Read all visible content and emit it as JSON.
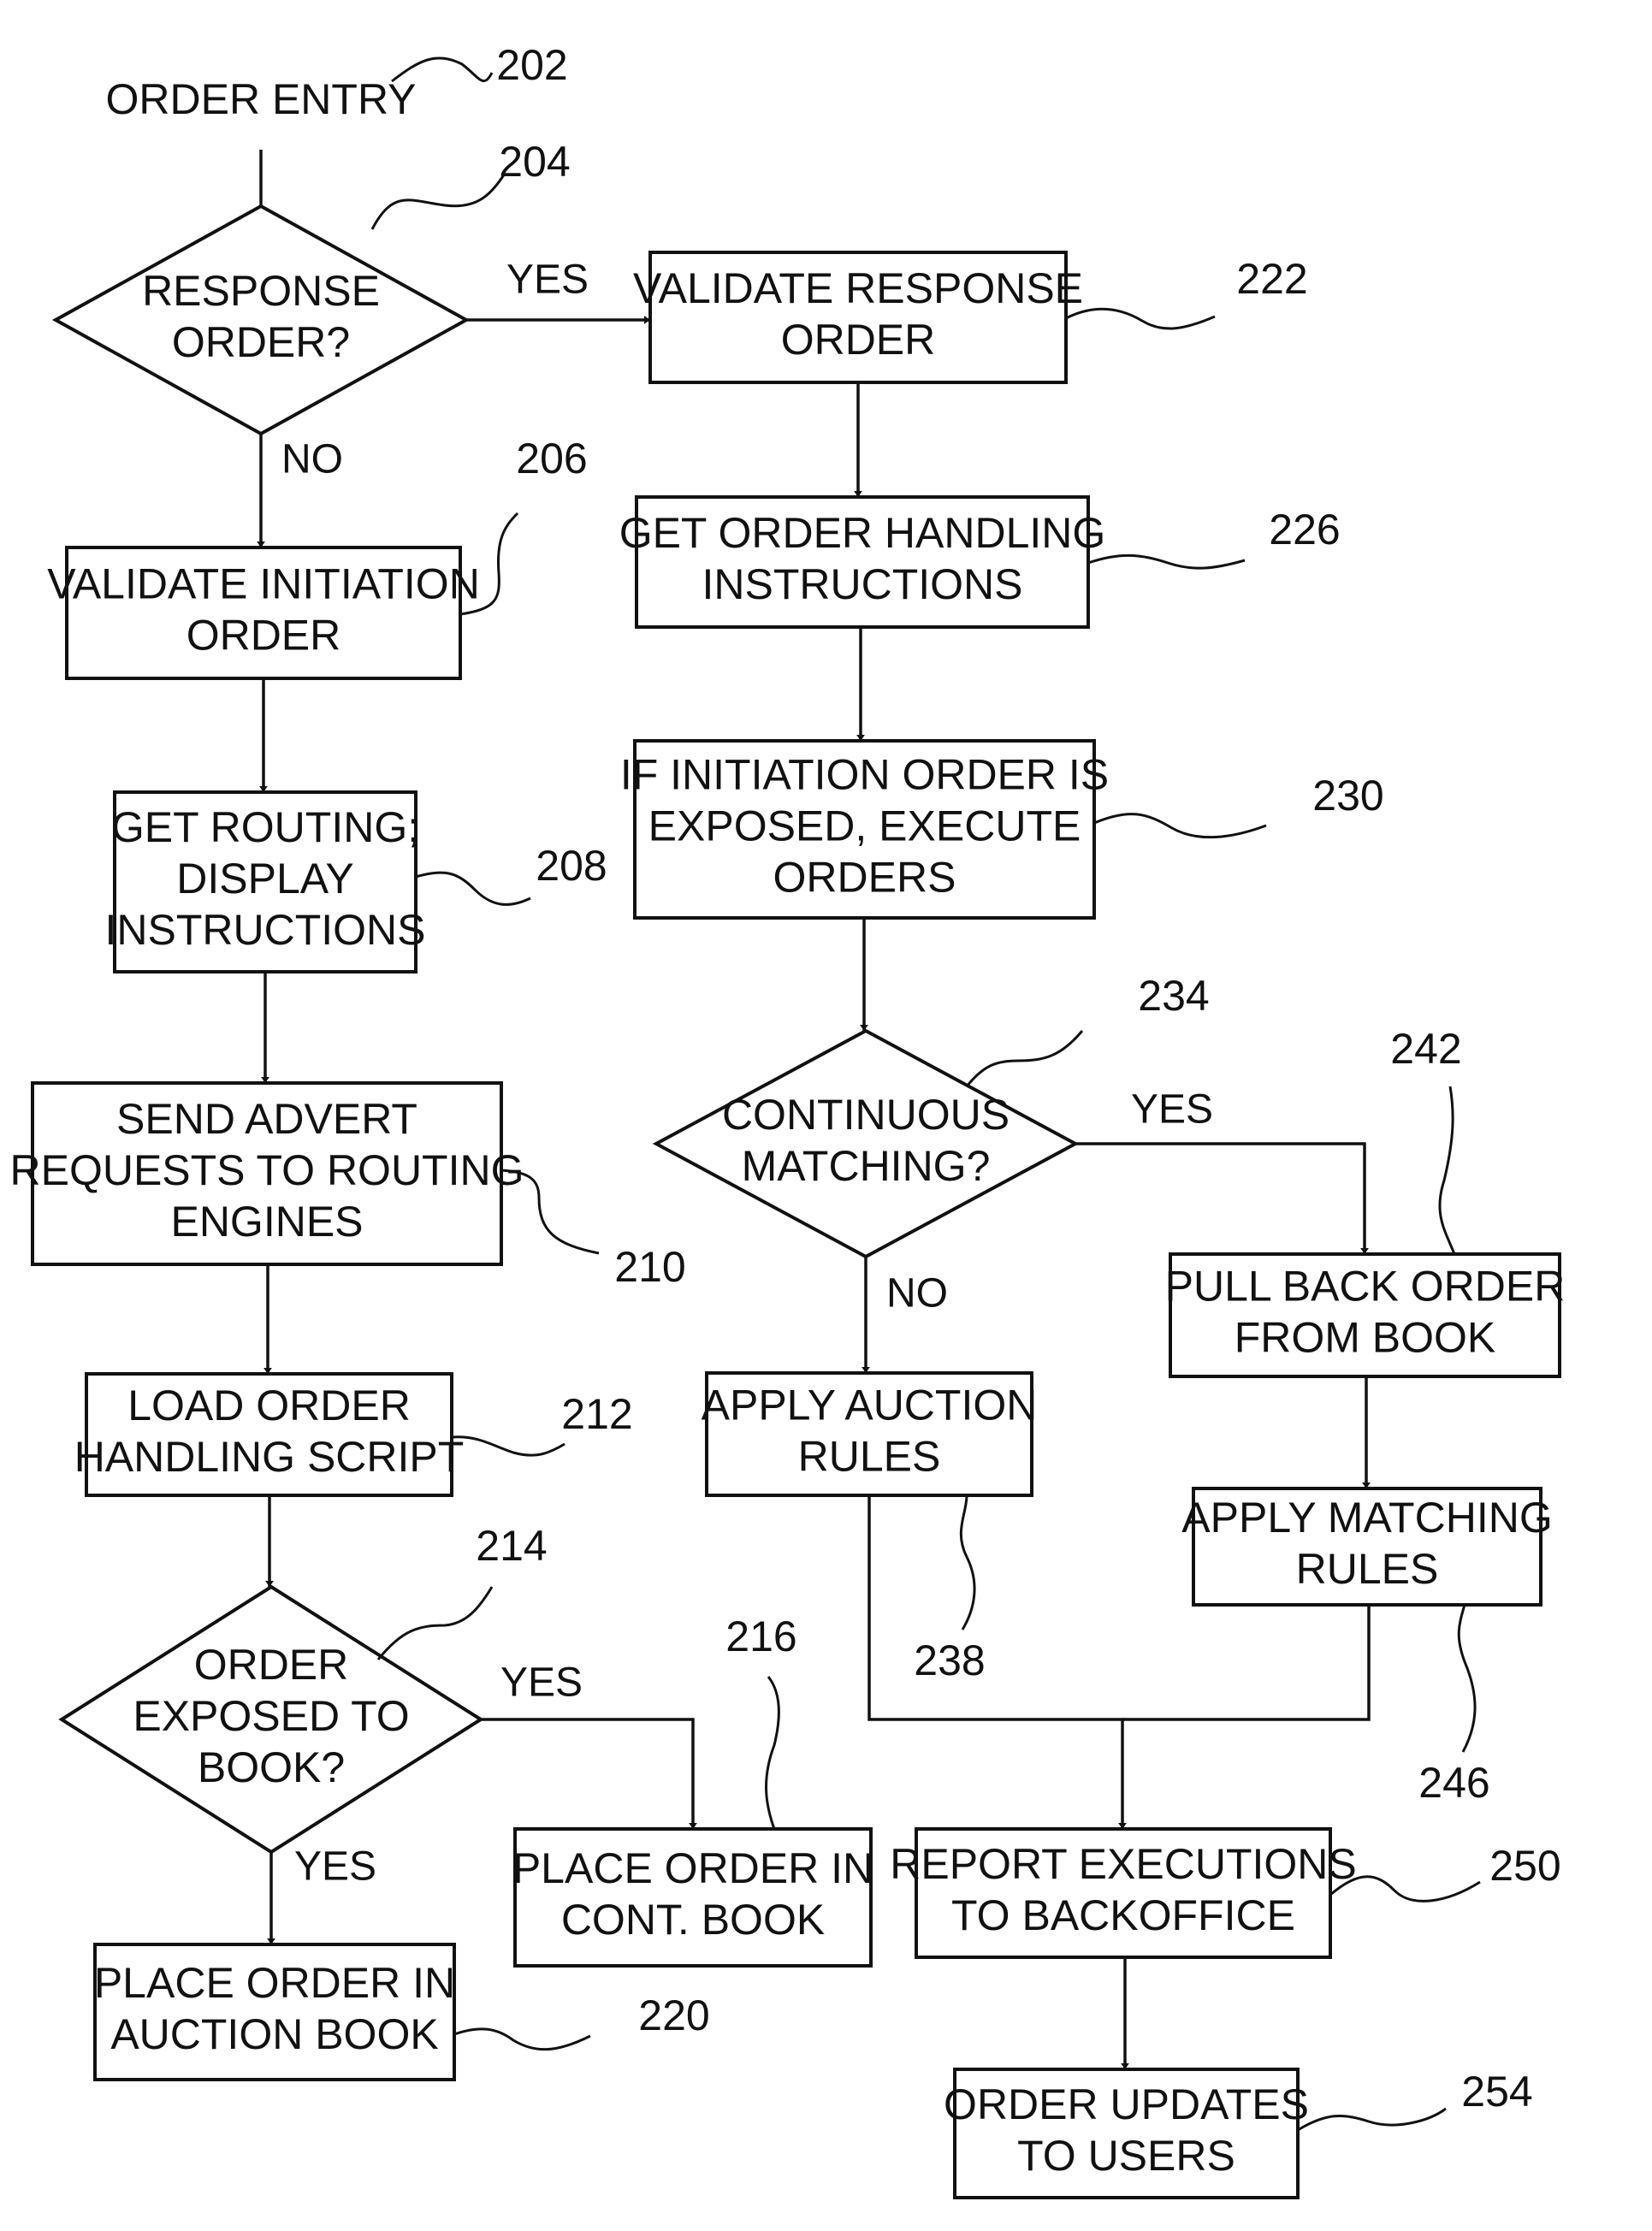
{
  "diagram": {
    "type": "flowchart",
    "start": {
      "text": "ORDER ENTRY",
      "ref": "202"
    },
    "nodes": [
      {
        "id": "204",
        "kind": "decision",
        "lines": [
          "RESPONSE",
          "ORDER?"
        ]
      },
      {
        "id": "206",
        "kind": "process",
        "lines": [
          "VALIDATE INITIATION",
          "ORDER"
        ]
      },
      {
        "id": "208",
        "kind": "process",
        "lines": [
          "GET ROUTING;",
          "DISPLAY",
          "INSTRUCTIONS"
        ]
      },
      {
        "id": "210",
        "kind": "process",
        "lines": [
          "SEND ADVERT",
          "REQUESTS TO ROUTING",
          "ENGINES"
        ]
      },
      {
        "id": "212",
        "kind": "process",
        "lines": [
          "LOAD ORDER",
          "HANDLING SCRIPT"
        ]
      },
      {
        "id": "214",
        "kind": "decision",
        "lines": [
          "ORDER",
          "EXPOSED TO",
          "BOOK?"
        ]
      },
      {
        "id": "216",
        "kind": "process",
        "lines": [
          "PLACE ORDER IN",
          "CONT. BOOK"
        ]
      },
      {
        "id": "220",
        "kind": "process",
        "lines": [
          "PLACE ORDER IN",
          "AUCTION BOOK"
        ]
      },
      {
        "id": "222",
        "kind": "process",
        "lines": [
          "VALIDATE RESPONSE",
          "ORDER"
        ]
      },
      {
        "id": "226",
        "kind": "process",
        "lines": [
          "GET ORDER HANDLING",
          "INSTRUCTIONS"
        ]
      },
      {
        "id": "230",
        "kind": "process",
        "lines": [
          "IF INITIATION ORDER IS",
          "EXPOSED, EXECUTE",
          "ORDERS"
        ]
      },
      {
        "id": "234",
        "kind": "decision",
        "lines": [
          "CONTINUOUS",
          "MATCHING?"
        ]
      },
      {
        "id": "238",
        "kind": "process",
        "lines": [
          "APPLY AUCTION",
          "RULES"
        ]
      },
      {
        "id": "242",
        "kind": "process",
        "lines": [
          "PULL BACK ORDER",
          "FROM BOOK"
        ]
      },
      {
        "id": "246",
        "kind": "process",
        "lines": [
          "APPLY MATCHING",
          "RULES"
        ]
      },
      {
        "id": "250",
        "kind": "process",
        "lines": [
          "REPORT EXECUTIONS",
          "TO BACKOFFICE"
        ]
      },
      {
        "id": "254",
        "kind": "process",
        "lines": [
          "ORDER UPDATES",
          "TO USERS"
        ]
      }
    ],
    "edges": [
      {
        "from": "202",
        "to": "204",
        "label": ""
      },
      {
        "from": "204",
        "to": "222",
        "label": "YES"
      },
      {
        "from": "204",
        "to": "206",
        "label": "NO"
      },
      {
        "from": "206",
        "to": "208",
        "label": ""
      },
      {
        "from": "208",
        "to": "210",
        "label": ""
      },
      {
        "from": "210",
        "to": "212",
        "label": ""
      },
      {
        "from": "212",
        "to": "214",
        "label": ""
      },
      {
        "from": "214",
        "to": "216",
        "label": "YES"
      },
      {
        "from": "214",
        "to": "220",
        "label": "YES"
      },
      {
        "from": "222",
        "to": "226",
        "label": ""
      },
      {
        "from": "226",
        "to": "230",
        "label": ""
      },
      {
        "from": "230",
        "to": "234",
        "label": ""
      },
      {
        "from": "234",
        "to": "242",
        "label": "YES"
      },
      {
        "from": "234",
        "to": "238",
        "label": "NO"
      },
      {
        "from": "242",
        "to": "246",
        "label": ""
      },
      {
        "from": "238",
        "to": "250",
        "label": ""
      },
      {
        "from": "246",
        "to": "250",
        "label": ""
      },
      {
        "from": "250",
        "to": "254",
        "label": ""
      }
    ]
  }
}
